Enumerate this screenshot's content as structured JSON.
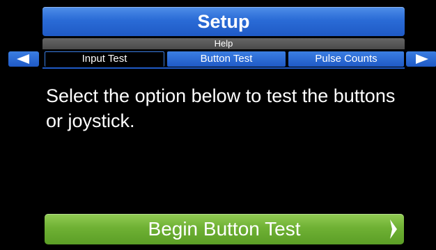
{
  "header": {
    "title": "Setup",
    "help_label": "Help"
  },
  "tabs": [
    {
      "label": "Input Test",
      "active": true
    },
    {
      "label": "Button Test",
      "active": false
    },
    {
      "label": "Pulse Counts",
      "active": false
    }
  ],
  "nav": {
    "prev_icon": "triangle-left-icon",
    "next_icon": "triangle-right-icon"
  },
  "main": {
    "message": "Select the option below to test the buttons or joystick."
  },
  "action": {
    "begin_label": "Begin Button Test",
    "icon": "chevron-right-icon"
  },
  "colors": {
    "title_blue": "#2a6bd6",
    "button_green": "#6fb134",
    "background": "#000000",
    "text": "#ffffff"
  }
}
